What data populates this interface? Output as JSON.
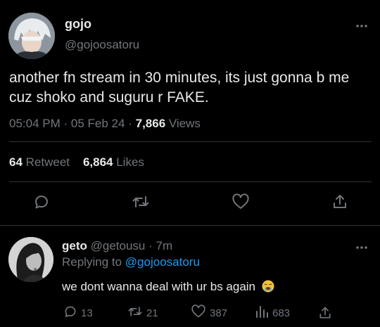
{
  "tweet": {
    "display_name": "gojo",
    "handle": "@gojoosatoru",
    "text": "another fn stream in 30 minutes, its just gonna b me cuz shoko and suguru r FAKE.",
    "time": "05:04 PM",
    "sep1": "·",
    "date": "05 Feb 24",
    "sep2": "·",
    "views_count": "7,866",
    "views_label": "Views",
    "retweets_count": "64",
    "retweets_label": "Retweet",
    "likes_count": "6,864",
    "likes_label": "Likes",
    "icons": [
      "more-icon",
      "reply-icon",
      "retweet-icon",
      "like-icon",
      "share-icon"
    ]
  },
  "reply": {
    "display_name": "geto",
    "handle": "@getousu",
    "sep": "·",
    "time_ago": "7m",
    "replying_label": "Replying to",
    "replying_handle": "@gojoosatoru",
    "text": "we dont wanna deal with ur bs again",
    "emoji": "loudly-crying-face",
    "reply_count": "13",
    "retweet_count": "21",
    "like_count": "387",
    "views_count": "683"
  },
  "colors": {
    "background": "#000000",
    "primary_text": "#e7e9ea",
    "secondary_text": "#71767b",
    "link": "#1d9bf0",
    "divider": "#2f3336"
  }
}
